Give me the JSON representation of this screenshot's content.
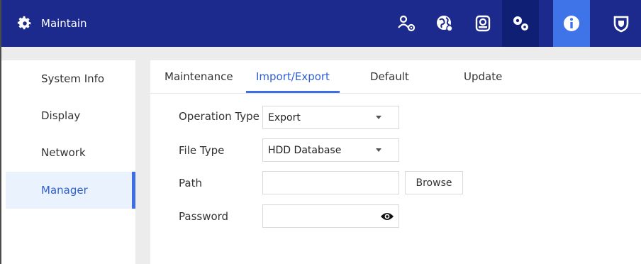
{
  "header": {
    "title": "Maintain",
    "icons": [
      "account-settings-icon",
      "network-globe-icon",
      "storage-disk-icon",
      "system-gears-icon",
      "info-icon",
      "security-shield-icon"
    ],
    "active_icon": "info-icon"
  },
  "sidebar": {
    "items": [
      {
        "label": "System Info"
      },
      {
        "label": "Display"
      },
      {
        "label": "Network"
      },
      {
        "label": "Manager"
      }
    ],
    "active": "Manager"
  },
  "tabs": {
    "items": [
      {
        "label": "Maintenance"
      },
      {
        "label": "Import/Export"
      },
      {
        "label": "Default"
      },
      {
        "label": "Update"
      }
    ],
    "active": "Import/Export"
  },
  "form": {
    "operation_type": {
      "label": "Operation Type",
      "value": "Export"
    },
    "file_type": {
      "label": "File Type",
      "value": "HDD Database"
    },
    "path": {
      "label": "Path",
      "value": ""
    },
    "browse_label": "Browse",
    "password": {
      "label": "Password",
      "value": ""
    }
  },
  "colors": {
    "header_bg": "#1b2a8c",
    "accent": "#3d6ee6",
    "active_tab_text": "#2e5fd4"
  }
}
